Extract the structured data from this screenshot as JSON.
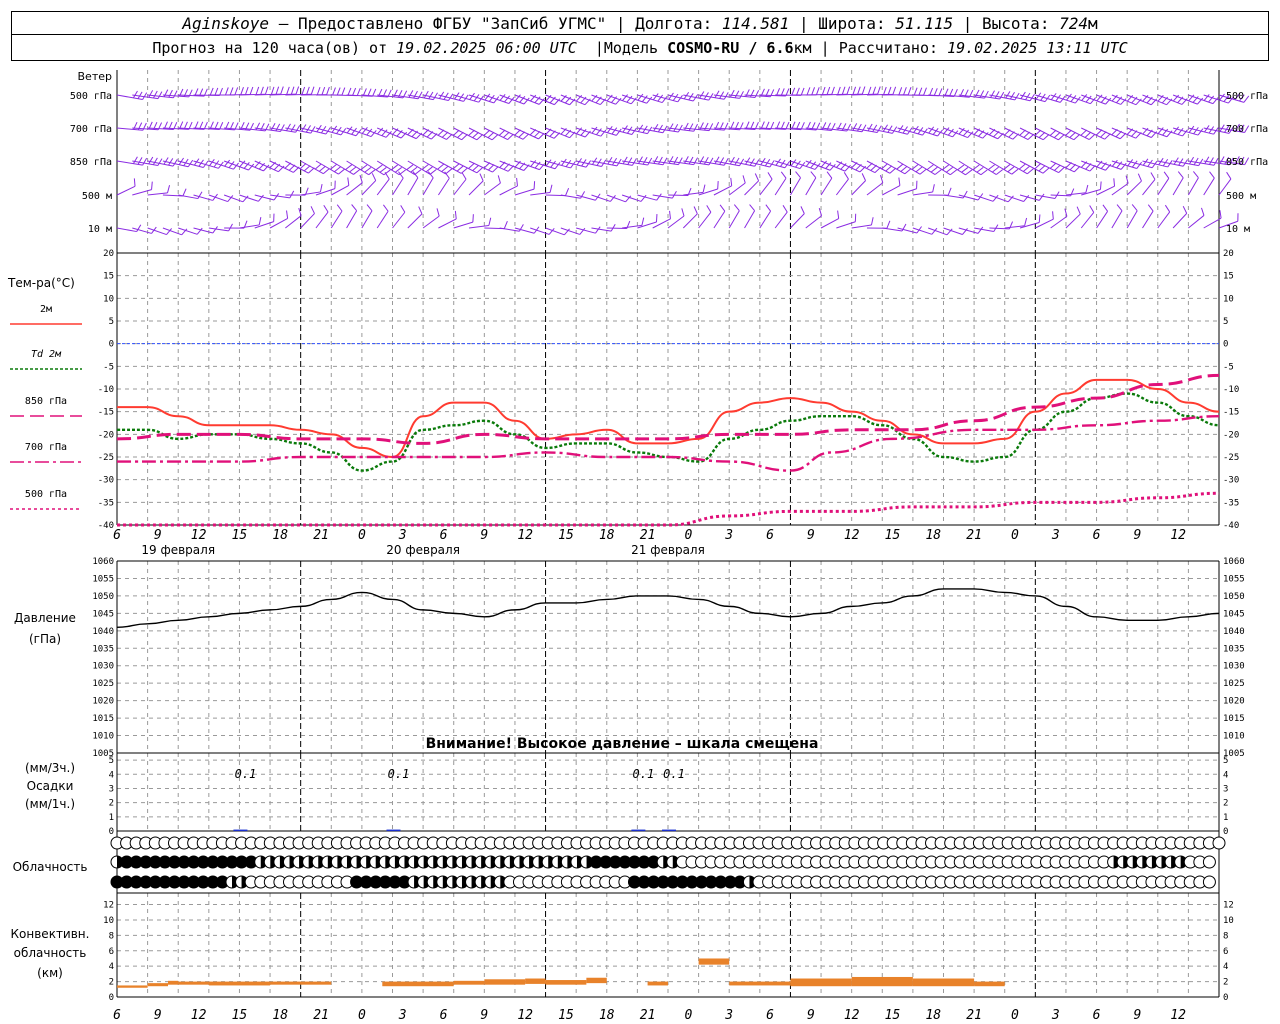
{
  "header": {
    "location": "Aginskoye",
    "dash": "–",
    "provider": "Предоставлено ФГБУ \"ЗапСиб УГМС\"",
    "sep": "|",
    "lon_label": "Долгота:",
    "lon_value": "114.581",
    "lat_label": "Широта:",
    "lat_value": "51.115",
    "alt_label": "Высота:",
    "alt_value": "724",
    "alt_unit": "м"
  },
  "subheader": {
    "forecast_label": "Прогноз на 120 часа(ов) от",
    "run_time": "19.02.2025 06:00 UTC",
    "model_label": "Модель",
    "model_name": "COSMO-RU / 6.6",
    "model_unit": "км",
    "calc_label": "Рассчитано:",
    "calc_time": "19.02.2025 13:11 UTC"
  },
  "colors": {
    "wind": "#8a2be2",
    "t2m": "#ff3b30",
    "td2m": "#0a7a0a",
    "t850": "#e0107a",
    "t700": "#e0107a",
    "t500": "#e0107a",
    "zero_line": "#3050ff",
    "pressure": "#000000",
    "precip": "#1a2fd0",
    "convective": "#e8822a",
    "grid": "#9a9a9a"
  },
  "chart_data": {
    "type": "line",
    "x_ticks": [
      "6",
      "9",
      "12",
      "15",
      "18",
      "21",
      "0",
      "3",
      "6",
      "9",
      "12",
      "15",
      "18",
      "21",
      "0",
      "3",
      "6",
      "9",
      "12",
      "15",
      "18",
      "21",
      "0",
      "3",
      "6",
      "9",
      "12"
    ],
    "date_labels": [
      "19 февраля",
      "20 февраля",
      "21 февраля"
    ],
    "wind": {
      "title": "Ветер",
      "levels": [
        "500 гПа",
        "700 гПа",
        "850 гПа",
        "500 м",
        "10 м"
      ]
    },
    "temperature": {
      "title": "Тем-ра(°C)",
      "y_ticks": [
        "20",
        "15",
        "10",
        "5",
        "0",
        "-5",
        "-10",
        "-15",
        "-20",
        "-25",
        "-30",
        "-35",
        "-40"
      ],
      "ylim": [
        -40,
        20
      ],
      "legend": [
        "2м",
        "Td 2м",
        "850 гПа",
        "700 гПа",
        "500 гПа"
      ],
      "series": [
        {
          "name": "2м",
          "x": [
            0,
            3,
            6,
            9,
            12,
            15,
            18,
            21,
            24,
            27,
            30,
            33,
            36,
            39,
            42,
            45,
            48,
            51,
            54,
            57,
            60,
            63,
            66,
            69,
            72,
            75,
            78,
            81,
            84,
            87,
            90,
            93,
            96,
            99,
            102,
            105,
            108
          ],
          "values": [
            -14,
            -14,
            -16,
            -18,
            -18,
            -18,
            -19,
            -20,
            -23,
            -25,
            -16,
            -13,
            -13,
            -17,
            -21,
            -20,
            -19,
            -22,
            -22,
            -21,
            -15,
            -13,
            -12,
            -13,
            -15,
            -17,
            -20,
            -22,
            -22,
            -21,
            -15,
            -11,
            -8,
            -8,
            -10,
            -13,
            -15
          ]
        },
        {
          "name": "Td 2м",
          "x": [
            0,
            3,
            6,
            9,
            12,
            15,
            18,
            21,
            24,
            27,
            30,
            33,
            36,
            39,
            42,
            45,
            48,
            51,
            54,
            57,
            60,
            63,
            66,
            69,
            72,
            75,
            78,
            81,
            84,
            87,
            90,
            93,
            96,
            99,
            102,
            105,
            108
          ],
          "values": [
            -19,
            -19,
            -21,
            -20,
            -20,
            -21,
            -22,
            -24,
            -28,
            -26,
            -19,
            -18,
            -17,
            -20,
            -23,
            -22,
            -22,
            -24,
            -25,
            -26,
            -21,
            -19,
            -17,
            -16,
            -16,
            -18,
            -21,
            -25,
            -26,
            -25,
            -19,
            -15,
            -12,
            -11,
            -13,
            -16,
            -18
          ]
        },
        {
          "name": "850 гПа",
          "x": [
            0,
            6,
            12,
            18,
            24,
            30,
            36,
            42,
            48,
            54,
            60,
            66,
            72,
            78,
            84,
            90,
            96,
            102,
            108
          ],
          "values": [
            -21,
            -20,
            -20,
            -21,
            -21,
            -22,
            -20,
            -21,
            -21,
            -21,
            -20,
            -20,
            -19,
            -19,
            -17,
            -14,
            -12,
            -9,
            -7
          ]
        },
        {
          "name": "700 гПа",
          "x": [
            0,
            6,
            12,
            18,
            24,
            30,
            36,
            42,
            48,
            54,
            60,
            66,
            70,
            76,
            84,
            90,
            96,
            102,
            108
          ],
          "values": [
            -26,
            -26,
            -26,
            -25,
            -25,
            -25,
            -25,
            -24,
            -25,
            -25,
            -26,
            -28,
            -24,
            -21,
            -19,
            -19,
            -18,
            -17,
            -16
          ]
        },
        {
          "name": "500 гПа",
          "x": [
            0,
            6,
            12,
            18,
            24,
            30,
            36,
            42,
            48,
            54,
            60,
            66,
            72,
            78,
            84,
            90,
            96,
            102,
            108
          ],
          "values": [
            -40,
            -41,
            -42,
            -42,
            -40,
            -40,
            -40,
            -40,
            -42,
            -40,
            -38,
            -37,
            -37,
            -36,
            -36,
            -35,
            -35,
            -34,
            -33
          ]
        }
      ]
    },
    "pressure": {
      "title_line1": "Давление",
      "title_line2": "(гПа)",
      "y_ticks": [
        "1060",
        "1055",
        "1050",
        "1045",
        "1040",
        "1035",
        "1030",
        "1025",
        "1020",
        "1015",
        "1010",
        "1005"
      ],
      "ylim": [
        1005,
        1060
      ],
      "warning": "Внимание! Высокое давление – шкала смещена",
      "x": [
        0,
        3,
        6,
        9,
        12,
        15,
        18,
        21,
        24,
        27,
        30,
        33,
        36,
        39,
        42,
        45,
        48,
        51,
        54,
        57,
        60,
        63,
        66,
        69,
        72,
        75,
        78,
        81,
        84,
        87,
        90,
        93,
        96,
        99,
        102,
        105,
        108
      ],
      "values": [
        1041,
        1042,
        1043,
        1044,
        1045,
        1046,
        1047,
        1049,
        1051,
        1049,
        1046,
        1045,
        1044,
        1046,
        1048,
        1048,
        1049,
        1050,
        1050,
        1049,
        1047,
        1045,
        1044,
        1045,
        1047,
        1048,
        1050,
        1052,
        1052,
        1051,
        1050,
        1047,
        1044,
        1043,
        1043,
        1044,
        1045
      ]
    },
    "precip": {
      "label_top": "(мм/3ч.)",
      "label_mid": "Осадки",
      "label_bot": "(мм/1ч.)",
      "y_ticks": [
        "5",
        "4",
        "3",
        "2",
        "1",
        "0"
      ],
      "ylim": [
        0,
        5.5
      ],
      "annotations": [
        {
          "x": 12,
          "text": "0.1"
        },
        {
          "x": 27,
          "text": "0.1"
        },
        {
          "x": 51,
          "text": "0.1"
        },
        {
          "x": 54,
          "text": "0.1"
        }
      ],
      "bars": [
        {
          "x": 12,
          "value": 0.1
        },
        {
          "x": 27,
          "value": 0.1
        },
        {
          "x": 51,
          "value": 0.1
        },
        {
          "x": 54,
          "value": 0.1
        }
      ]
    },
    "cloud": {
      "title": "Облачность",
      "rows": [
        "oooooooooooooooooooooooooooooooooooooooooooooooooooooooooooooooooooooooooooooooooooooooooooooooooooooooooooooooooooo",
        "hffffffffffffffhhhhhhhhhhhhhhhhhhhhhhhhhhhhhhhhhhhfffffffhhooooooooooooooooooooooooooooooooooooooooooooohhhhhhhhooo",
        "ffffffffffffhhoooooooooooffffffhhhhhhhhhhoooooooooooooffffffffffffhoooooooooooooooooooooooooooooooooooooooooooooooo"
      ]
    },
    "convective": {
      "title_line1": "Конвективн.",
      "title_line2": "облачность",
      "title_line3": "(км)",
      "y_ticks": [
        "12",
        "10",
        "8",
        "6",
        "4",
        "2",
        "0"
      ],
      "ylim": [
        0,
        13.5
      ],
      "segments": [
        {
          "x0": 0,
          "x1": 3,
          "base": 1.2,
          "top": 1.5
        },
        {
          "x0": 3,
          "x1": 5,
          "base": 1.4,
          "top": 1.8
        },
        {
          "x0": 5,
          "x1": 6,
          "base": 1.6,
          "top": 2.1
        },
        {
          "x0": 6,
          "x1": 9,
          "base": 1.6,
          "top": 2.0
        },
        {
          "x0": 9,
          "x1": 15,
          "base": 1.5,
          "top": 2.0
        },
        {
          "x0": 15,
          "x1": 21,
          "base": 1.6,
          "top": 2.0
        },
        {
          "x0": 26,
          "x1": 33,
          "base": 1.4,
          "top": 2.0
        },
        {
          "x0": 33,
          "x1": 36,
          "base": 1.6,
          "top": 2.1
        },
        {
          "x0": 36,
          "x1": 40,
          "base": 1.6,
          "top": 2.3
        },
        {
          "x0": 40,
          "x1": 42,
          "base": 1.7,
          "top": 2.4
        },
        {
          "x0": 42,
          "x1": 46,
          "base": 1.6,
          "top": 2.2
        },
        {
          "x0": 46,
          "x1": 48,
          "base": 1.8,
          "top": 2.5
        },
        {
          "x0": 52,
          "x1": 54,
          "base": 1.5,
          "top": 2.0
        },
        {
          "x0": 57,
          "x1": 60,
          "base": 4.2,
          "top": 5.0
        },
        {
          "x0": 60,
          "x1": 66,
          "base": 1.5,
          "top": 2.0
        },
        {
          "x0": 66,
          "x1": 72,
          "base": 1.4,
          "top": 2.4
        },
        {
          "x0": 72,
          "x1": 78,
          "base": 1.4,
          "top": 2.6
        },
        {
          "x0": 78,
          "x1": 84,
          "base": 1.4,
          "top": 2.4
        },
        {
          "x0": 84,
          "x1": 87,
          "base": 1.4,
          "top": 2.0
        }
      ]
    }
  }
}
